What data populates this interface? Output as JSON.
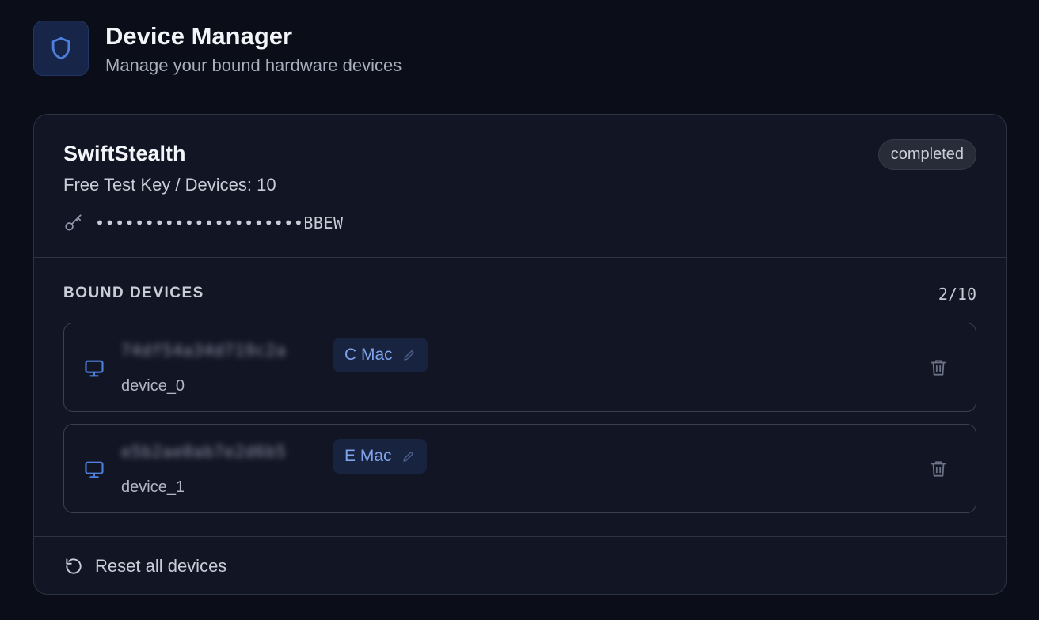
{
  "header": {
    "title": "Device Manager",
    "subtitle": "Manage your bound hardware devices",
    "logo_icon": "shield-icon"
  },
  "license": {
    "name": "SwiftStealth",
    "description": "Free Test Key / Devices: 10",
    "masked_key": "•••••••••••••••••••••BBEW",
    "status": "completed"
  },
  "devices": {
    "section_title": "BOUND DEVICES",
    "count": "2/10",
    "items": [
      {
        "id": "74df54a34d719c2a",
        "tag": "C Mac",
        "label": "device_0"
      },
      {
        "id": "e5b2ae0ab7e2d6b5",
        "tag": "E Mac",
        "label": "device_1"
      }
    ]
  },
  "footer": {
    "reset_label": "Reset all devices"
  },
  "colors": {
    "accent": "#4d7fdc",
    "background": "#0b0e18",
    "card": "#121624"
  }
}
